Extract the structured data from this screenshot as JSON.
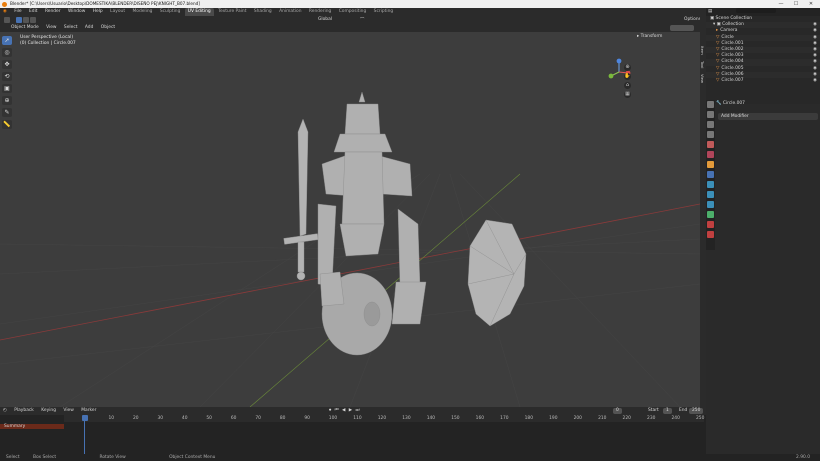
{
  "titlebar": {
    "title": "Blender* [C:\\Users\\Usuario\\Desktop\\DOMESTIKA\\BLENDER\\DISEÑO PEJ\\KNIGHT_B07.blend]",
    "minimize": "—",
    "maximize": "☐",
    "close": "✕"
  },
  "menu": {
    "items": [
      "File",
      "Edit",
      "Render",
      "Window",
      "Help"
    ],
    "workspaces": [
      "Layout",
      "Modeling",
      "Sculpting",
      "UV Editing",
      "Texture Paint",
      "Shading",
      "Animation",
      "Rendering",
      "Compositing",
      "Scripting"
    ],
    "active_workspace": "UV Editing",
    "scene_label": "Scene",
    "view_layer_label": "View Layer"
  },
  "viewport": {
    "mode": "Object Mode",
    "menus": [
      "View",
      "Select",
      "Add",
      "Object"
    ],
    "transform_orientation": "Global",
    "options_label": "Options",
    "overlay_line1": "User Perspective (Local)",
    "overlay_line2": "(0) Collection | Circle.007",
    "npanel_transform": "Transform",
    "side_tabs": [
      "Item",
      "Tool",
      "View"
    ],
    "gizmo": {
      "x": "X",
      "y": "Y",
      "z": "Z"
    }
  },
  "outliner": {
    "search_placeholder": "",
    "root": "Scene Collection",
    "collection": "Collection",
    "items": [
      "Camera",
      "Circle",
      "Circle.001",
      "Circle.002",
      "Circle.003",
      "Circle.004",
      "Circle.005",
      "Circle.006",
      "Circle.007"
    ]
  },
  "properties": {
    "object_name": "Circle.007",
    "add_modifier": "Add Modifier"
  },
  "timeline": {
    "menus": [
      "Playback",
      "Keying",
      "View",
      "Marker"
    ],
    "current_frame": "0",
    "start_label": "Start",
    "start_value": "1",
    "end_label": "End",
    "end_value": "250",
    "summary": "Summary",
    "ticks": [
      "0",
      "10",
      "20",
      "30",
      "40",
      "50",
      "60",
      "70",
      "80",
      "90",
      "100",
      "110",
      "120",
      "130",
      "140",
      "150",
      "160",
      "170",
      "180",
      "190",
      "200",
      "210",
      "220",
      "230",
      "240",
      "250"
    ]
  },
  "status": {
    "select": "Select",
    "box_select": "Box Select",
    "rotate_view": "Rotate View",
    "context_menu": "Object Context Menu",
    "version": "2.90.0"
  },
  "colors": {
    "accent": "#4772b3",
    "viewport_bg": "#3d3d3d",
    "object": "#b5b5b5"
  }
}
